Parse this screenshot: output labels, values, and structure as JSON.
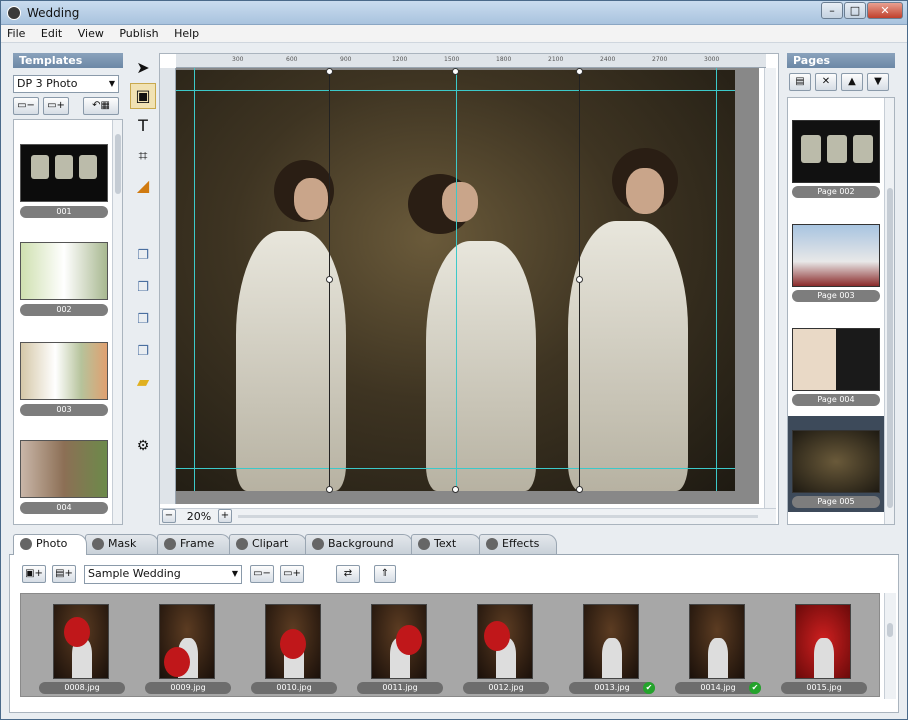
{
  "window": {
    "title": "Wedding",
    "min": "–",
    "max": "□",
    "close": "✕"
  },
  "menu": [
    "File",
    "Edit",
    "View",
    "Publish",
    "Help"
  ],
  "templates": {
    "header": "Templates",
    "dropdown": "DP 3 Photo",
    "items": [
      "001",
      "002",
      "003",
      "004"
    ]
  },
  "ruler_ticks": [
    "300",
    "600",
    "900",
    "1200",
    "1500",
    "1800",
    "2100",
    "2400",
    "2700",
    "3000"
  ],
  "zoom": {
    "value": "20%",
    "minus": "−",
    "plus": "+"
  },
  "pages": {
    "header": "Pages",
    "items": [
      "Page 002",
      "Page 003",
      "Page 004",
      "Page 005"
    ]
  },
  "tabs": [
    "Photo",
    "Mask",
    "Frame",
    "Clipart",
    "Background",
    "Text",
    "Effects"
  ],
  "photo_panel": {
    "album": "Sample Wedding",
    "photos": [
      {
        "name": "0008.jpg",
        "used": false
      },
      {
        "name": "0009.jpg",
        "used": false
      },
      {
        "name": "0010.jpg",
        "used": false
      },
      {
        "name": "0011.jpg",
        "used": false
      },
      {
        "name": "0012.jpg",
        "used": false
      },
      {
        "name": "0013.jpg",
        "used": true
      },
      {
        "name": "0014.jpg",
        "used": true
      },
      {
        "name": "0015.jpg",
        "used": false
      }
    ]
  },
  "colors": {
    "guide": "#3cc9c9",
    "selected_tool": "#f1e2b3",
    "check": "#24a32c"
  }
}
